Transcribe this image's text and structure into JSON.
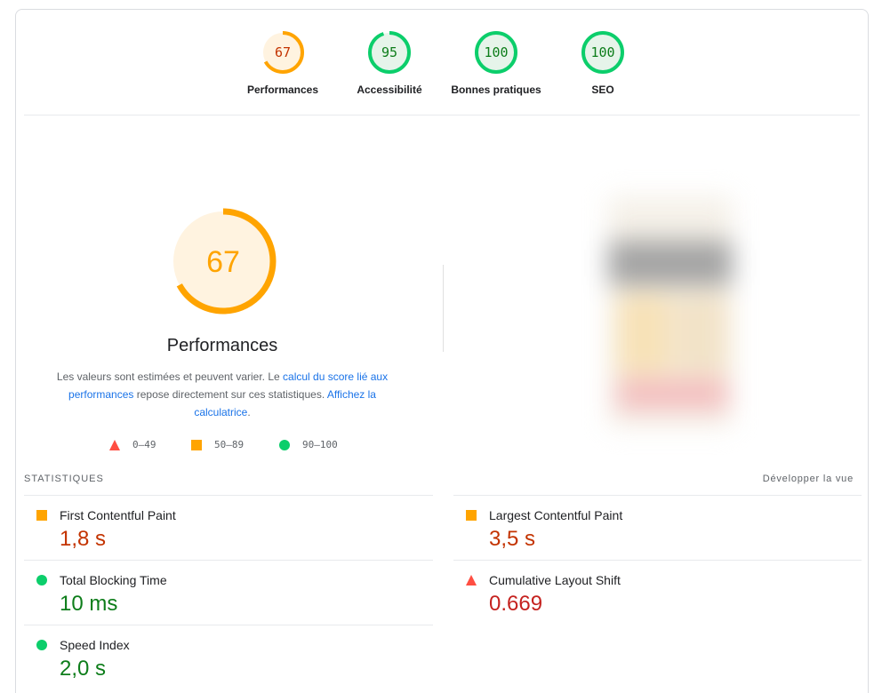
{
  "categories": [
    {
      "score": "67",
      "label": "Performances",
      "fraction": 0.67,
      "color": "#ffa400",
      "bg": "#fff3e0",
      "text_color": "#c33300"
    },
    {
      "score": "95",
      "label": "Accessibilité",
      "fraction": 0.95,
      "color": "#0cce6b",
      "bg": "#e6f4ea",
      "text_color": "#0d7d1a"
    },
    {
      "score": "100",
      "label": "Bonnes pratiques",
      "fraction": 1.0,
      "color": "#0cce6b",
      "bg": "#e6f4ea",
      "text_color": "#0d7d1a"
    },
    {
      "score": "100",
      "label": "SEO",
      "fraction": 1.0,
      "color": "#0cce6b",
      "bg": "#e6f4ea",
      "text_color": "#0d7d1a"
    }
  ],
  "performance": {
    "score": "67",
    "fraction": 0.67,
    "title": "Performances",
    "desc_1": "Les valeurs sont estimées et peuvent varier. Le ",
    "desc_link_1": "calcul du score lié aux performances",
    "desc_2": " repose directement sur ces statistiques. ",
    "desc_link_2": "Affichez la calculatrice",
    "desc_3": "."
  },
  "legend": [
    {
      "shape": "triangle",
      "range": "0–49",
      "color": "#ff4e42"
    },
    {
      "shape": "square",
      "range": "50–89",
      "color": "#ffa400"
    },
    {
      "shape": "circle",
      "range": "90–100",
      "color": "#0cce6b"
    }
  ],
  "metrics": {
    "header": "STATISTIQUES",
    "expand_label": "Développer la vue",
    "left": [
      {
        "name": "First Contentful Paint",
        "value": "1,8 s",
        "rating": "average"
      },
      {
        "name": "Total Blocking Time",
        "value": "10 ms",
        "rating": "pass"
      },
      {
        "name": "Speed Index",
        "value": "2,0 s",
        "rating": "pass"
      }
    ],
    "right": [
      {
        "name": "Largest Contentful Paint",
        "value": "3,5 s",
        "rating": "average"
      },
      {
        "name": "Cumulative Layout Shift",
        "value": "0.669",
        "rating": "fail"
      }
    ]
  },
  "colors": {
    "fail": "#ff4e42",
    "average": "#ffa400",
    "pass": "#0cce6b",
    "link": "#1a73e8"
  }
}
